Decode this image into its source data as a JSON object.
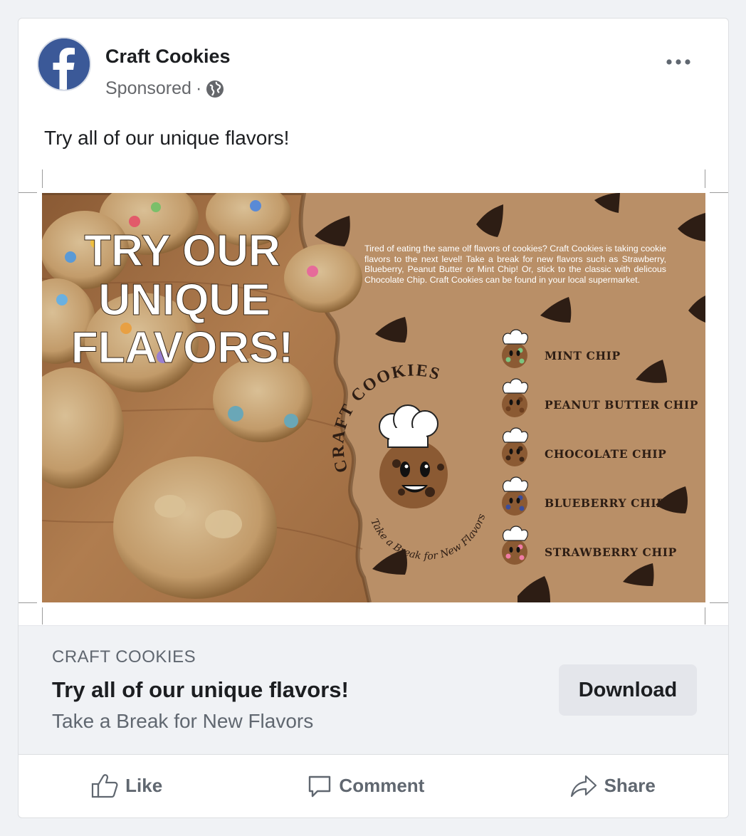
{
  "post": {
    "page_name": "Craft Cookies",
    "sponsored_label": "Sponsored",
    "separator": "·",
    "text": "Try all of our unique flavors!"
  },
  "creative": {
    "headline_lines": [
      "TRY OUR",
      "UNIQUE",
      "FLAVORS!"
    ],
    "blurb": "Tired of eating the same olf flavors of cookies? Craft Cookies is taking cookie flavors to the next level! Take a break for new flavors such as Strawberry, Blueberry, Peanut Butter or Mint Chip! Or, stick to the classic with delicous Chocolate Chip. Craft Cookies can be found in your local supermarket.",
    "logo_text": "CRAFT COOKIES",
    "logo_tagline": "Take a Break for New Flavors",
    "flavors": [
      "MINT CHIP",
      "PEANUT BUTTER CHIP",
      "CHOCOLATE CHIP",
      "BLUEBERRY CHIP",
      "STRAWBERRY CHIP"
    ],
    "flavor_chip_colors": [
      "#7bc47f",
      "#6b3e1f",
      "#3a2416",
      "#3b4d9a",
      "#f07ca4"
    ],
    "background_color": "#b98f67"
  },
  "cta": {
    "domain": "CRAFT COOKIES",
    "headline": "Try all of our unique flavors!",
    "description": "Take a Break for New Flavors",
    "button_label": "Download"
  },
  "actions": {
    "like": "Like",
    "comment": "Comment",
    "share": "Share"
  }
}
